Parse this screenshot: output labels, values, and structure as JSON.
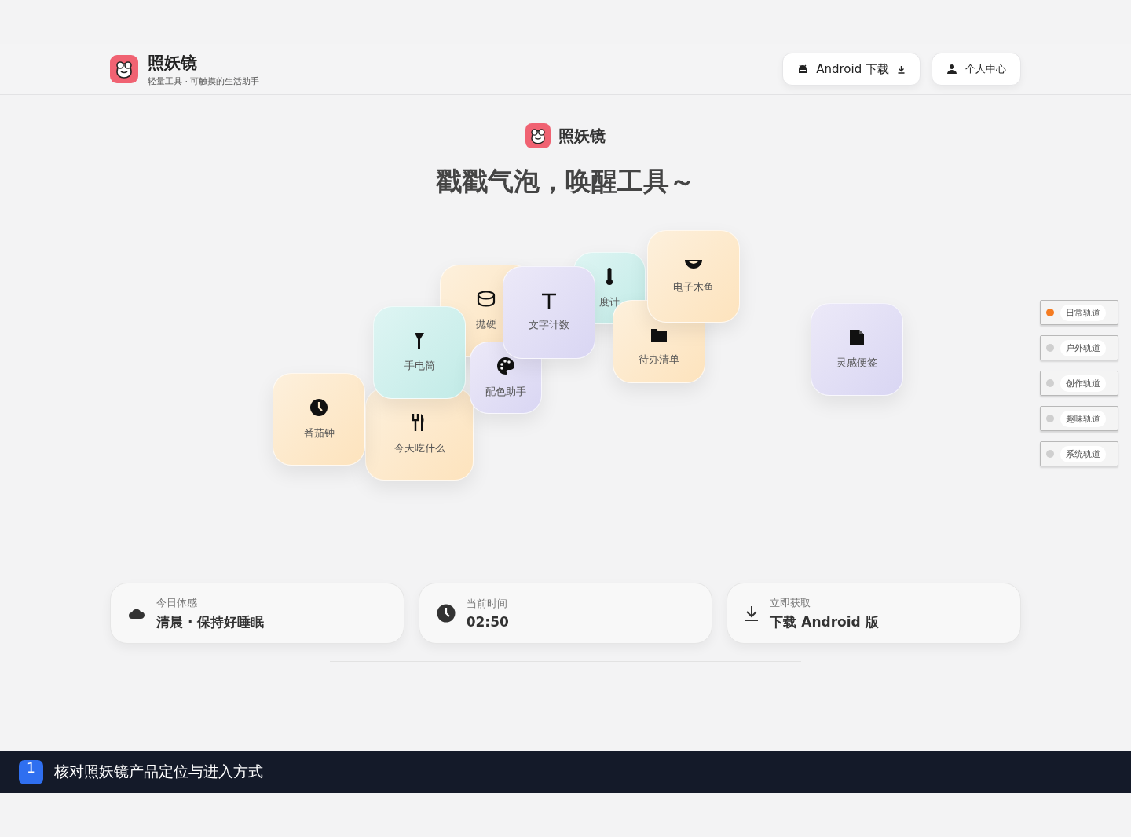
{
  "header": {
    "app_name": "照妖镜",
    "tagline": "轻量工具 · 可触摸的生活助手",
    "buttons": [
      {
        "kind": "android",
        "label": "Android 下载"
      },
      {
        "kind": "user",
        "label": "个人中心"
      }
    ]
  },
  "hero": {
    "brand": "照妖镜",
    "slogan": "戳戳气泡，唤醒工具～"
  },
  "bubbles": [
    {
      "label": "抛硬",
      "kind": "peach"
    },
    {
      "label": "度计",
      "kind": "teal"
    },
    {
      "label": "待办清单",
      "kind": "peach"
    },
    {
      "label": "电子木鱼",
      "kind": "peach"
    },
    {
      "label": "今天吃什么",
      "kind": "peach"
    },
    {
      "label": "番茄钟",
      "kind": "peach"
    },
    {
      "label": "手电筒",
      "kind": "teal"
    },
    {
      "label": "配色助手",
      "kind": "lavender"
    },
    {
      "label": "文字计数",
      "kind": "lavender"
    },
    {
      "label": "灵感便签",
      "kind": "lavender"
    }
  ],
  "tracks": [
    {
      "label": "日常轨道",
      "selected": true
    },
    {
      "label": "户外轨道",
      "selected": false
    },
    {
      "label": "创作轨道",
      "selected": false
    },
    {
      "label": "趣味轨道",
      "selected": false
    },
    {
      "label": "系统轨道",
      "selected": false
    }
  ],
  "info_cards": [
    {
      "kind": "weather",
      "caption": "今日体感",
      "value": "清晨 · 保持好睡眠"
    },
    {
      "kind": "time",
      "caption": "当前时间",
      "value": "02:50"
    },
    {
      "kind": "download",
      "caption": "立即获取",
      "value": "下载 Android 版"
    }
  ],
  "step_bar": {
    "number": "1",
    "text": "核对照妖镜产品定位与进入方式"
  }
}
